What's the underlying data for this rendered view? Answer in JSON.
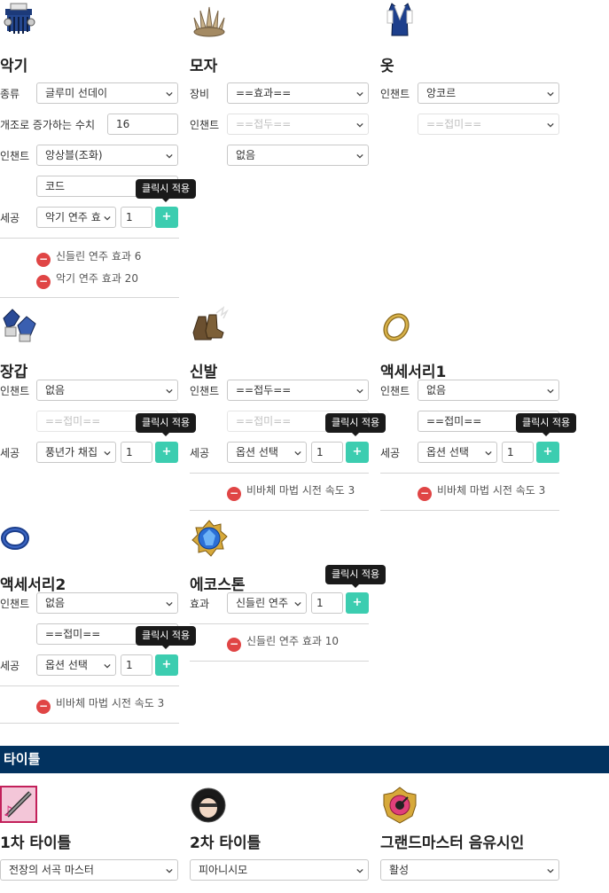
{
  "ui": {
    "tooltip": "클릭시 적용",
    "plus": "+",
    "minus": "−"
  },
  "colors": {
    "accent": "#3ccdb0",
    "remove": "#e04545",
    "section_bar": "#02325f"
  },
  "instrument": {
    "title": "악기",
    "type_label": "종류",
    "type_value": "글루미 선데이",
    "mod_label": "개조로 증가하는 수치",
    "mod_value": "16",
    "enchant_label": "인챈트",
    "enchant_value": "앙상블(조화)",
    "code_value": "코드",
    "craft_label": "세공",
    "craft_value": "악기 연주 효",
    "craft_qty": "1",
    "effects": [
      "신들린 연주 효과 6",
      "악기 연주 효과 20"
    ]
  },
  "hat": {
    "title": "모자",
    "gear_label": "장비",
    "gear_value": "==효과==",
    "enchant_label": "인챈트",
    "enchant_value": "==접두==",
    "extra_value": "없음"
  },
  "clothes": {
    "title": "옷",
    "enchant_label": "인챈트",
    "enchant_value": "앙코르",
    "suffix_value": "==접미=="
  },
  "gloves": {
    "title": "장갑",
    "enchant_label": "인챈트",
    "enchant_value": "없음",
    "suffix_value": "==접미==",
    "craft_label": "세공",
    "craft_value": "풍년가 채집",
    "craft_qty": "1"
  },
  "shoes": {
    "title": "신발",
    "enchant_label": "인챈트",
    "enchant_value": "==접두==",
    "suffix_value": "==접미==",
    "craft_label": "세공",
    "craft_value": "옵션 선택",
    "craft_qty": "1",
    "effects": [
      "비바체 마법 시전 속도 3"
    ]
  },
  "accessory1": {
    "title": "액세서리1",
    "enchant_label": "인챈트",
    "enchant_value": "없음",
    "suffix_value": "==접미==",
    "craft_label": "세공",
    "craft_value": "옵션 선택",
    "craft_qty": "1",
    "effects": [
      "비바체 마법 시전 속도 3"
    ]
  },
  "accessory2": {
    "title": "액세서리2",
    "enchant_label": "인챈트",
    "enchant_value": "없음",
    "suffix_value": "==접미==",
    "craft_label": "세공",
    "craft_value": "옵션 선택",
    "craft_qty": "1",
    "effects": [
      "비바체 마법 시전 속도 3"
    ]
  },
  "echostone": {
    "title": "에코스톤",
    "effect_label": "효과",
    "effect_value": "신들린 연주",
    "effect_qty": "1",
    "effects": [
      "신들린 연주 효과 10"
    ]
  },
  "titles_section": {
    "header": "타이틀",
    "first": {
      "title": "1차 타이틀",
      "value": "전장의 서곡 마스터"
    },
    "second": {
      "title": "2차 타이틀",
      "value": "피아니시모"
    },
    "grandmaster": {
      "title": "그랜드마스터 음유시인",
      "value": "활성"
    }
  }
}
